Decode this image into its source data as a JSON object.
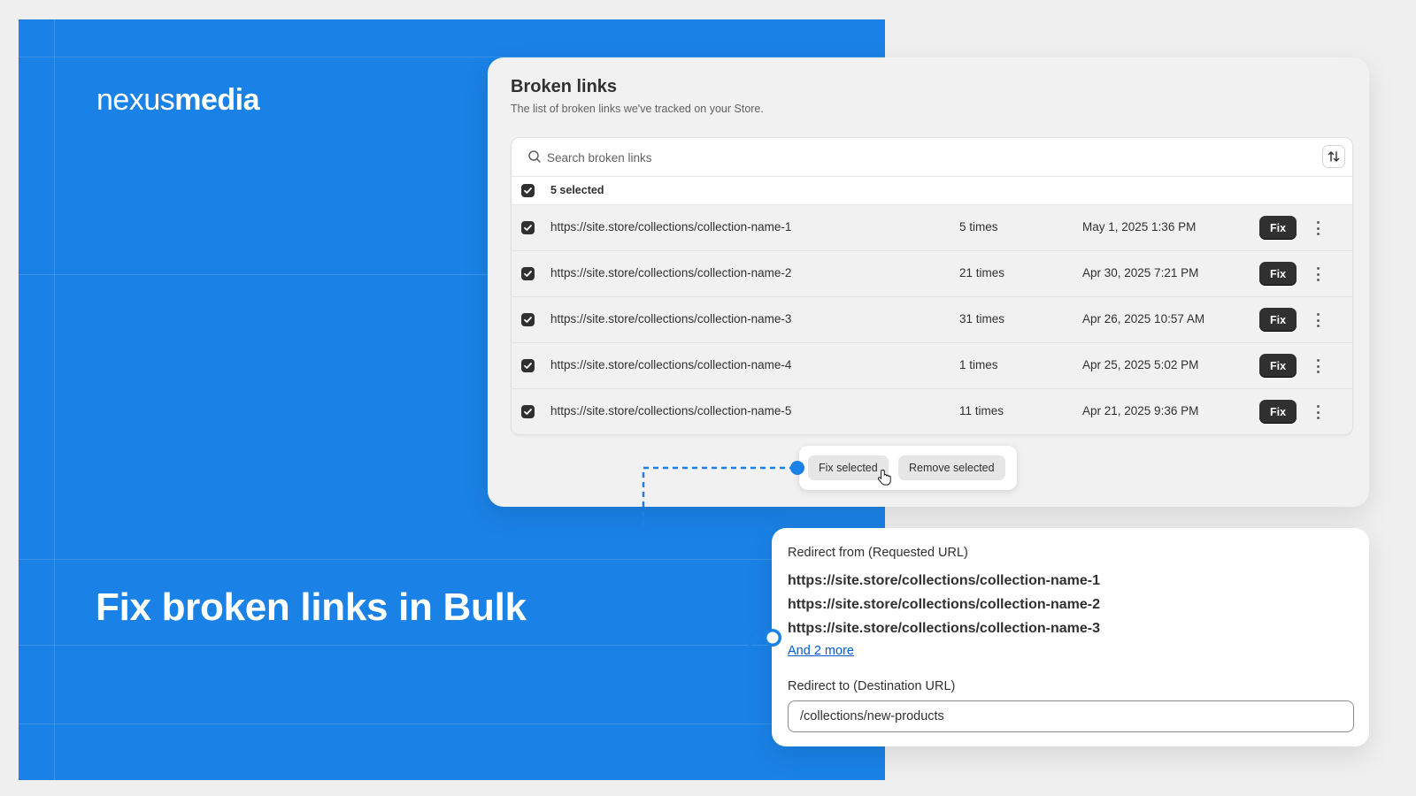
{
  "brand": {
    "name_light": "nexus",
    "name_bold": "media"
  },
  "hero": {
    "headline": "Fix broken links in Bulk"
  },
  "broken_links": {
    "title": "Broken links",
    "subtitle": "The list of broken links we've tracked on your Store.",
    "search_placeholder": "Search broken links",
    "selected_label": "5 selected",
    "fix_label": "Fix",
    "rows": [
      {
        "url": "https://site.store/collections/collection-name-1",
        "count": "5 times",
        "date": "May 1, 2025 1:36 PM"
      },
      {
        "url": "https://site.store/collections/collection-name-2",
        "count": "21 times",
        "date": "Apr 30, 2025 7:21 PM"
      },
      {
        "url": "https://site.store/collections/collection-name-3",
        "count": "31 times",
        "date": "Apr 26, 2025 10:57 AM"
      },
      {
        "url": "https://site.store/collections/collection-name-4",
        "count": "1 times",
        "date": "Apr 25, 2025 5:02 PM"
      },
      {
        "url": "https://site.store/collections/collection-name-5",
        "count": "11 times",
        "date": "Apr 21, 2025 9:36 PM"
      }
    ],
    "bulk": {
      "fix_selected": "Fix selected",
      "remove_selected": "Remove selected"
    }
  },
  "redirect": {
    "from_label": "Redirect from (Requested URL)",
    "from_urls": [
      "https://site.store/collections/collection-name-1",
      "https://site.store/collections/collection-name-2",
      "https://site.store/collections/collection-name-3"
    ],
    "more_link": "And 2 more",
    "to_label": "Redirect to (Destination URL)",
    "to_value": "/collections/new-products"
  },
  "colors": {
    "hero_blue": "#1a82e6",
    "connector_blue": "#1a82e6",
    "button_dark": "#303030",
    "link_blue": "#005bd3"
  }
}
